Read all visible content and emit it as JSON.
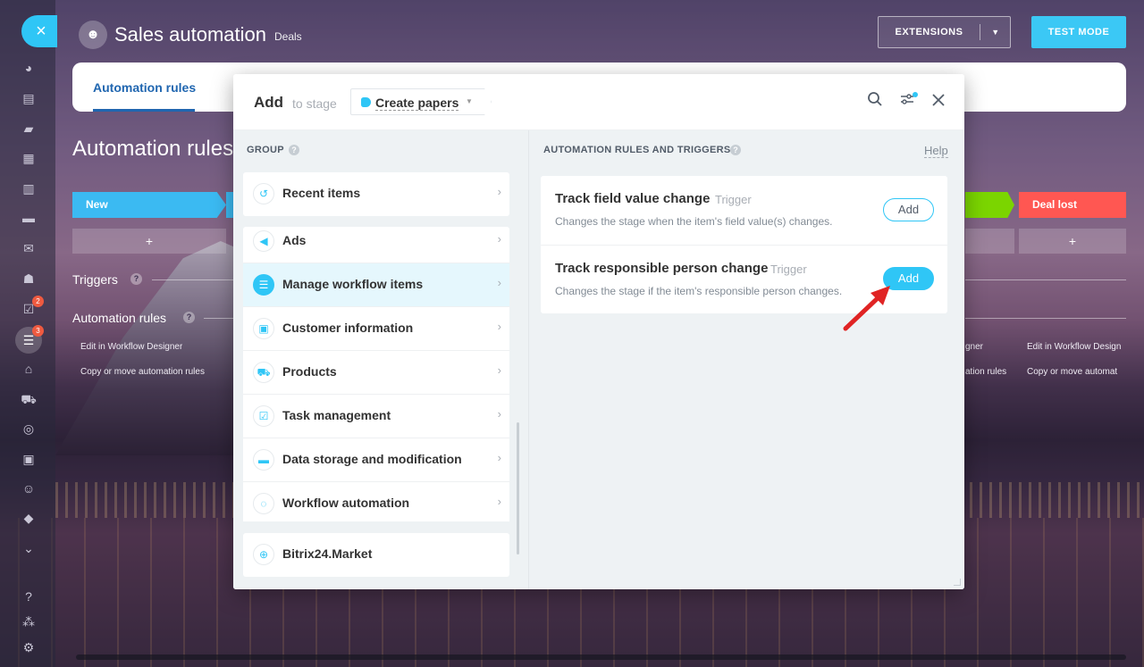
{
  "colors": {
    "accent": "#2fc6f6",
    "active_tab": "#2066b0",
    "stage_new": "#3bbaf2",
    "stage_won": "#7bd500",
    "stage_lost": "#ff5752",
    "annotation_arrow": "#e02424"
  },
  "sidebar": {
    "close_icon": "×",
    "badges": [
      "2",
      "3"
    ]
  },
  "header": {
    "title": "Sales automation",
    "subtitle": "Deals",
    "extensions_label": "EXTENSIONS",
    "test_mode_label": "TEST MODE"
  },
  "background": {
    "tab_active": "Automation rules",
    "heading": "Automation rules a",
    "stage_new": "New",
    "stage_lost": "Deal lost",
    "plus": "+",
    "triggers_label": "Triggers",
    "automation_rules_label": "Automation rules",
    "question_mark": "?",
    "link_edit": "Edit in Workflow Designer",
    "link_copy": "Copy or move automation rules",
    "link_edit_right_fragment": "gner",
    "link_copy_right_fragment": "ation rules",
    "link_edit_far_right": "Edit in Workflow Design",
    "link_copy_far_right": "Copy or move automat"
  },
  "popup": {
    "title": "Add",
    "to_stage": "to stage",
    "stage_name": "Create papers",
    "group_header": "GROUP",
    "rules_header": "AUTOMATION RULES AND TRIGGERS",
    "help_label": "Help",
    "groups": [
      {
        "label": "Recent items",
        "icon": "recent-icon"
      },
      {
        "label": "Ads",
        "icon": "megaphone-icon"
      },
      {
        "label": "Manage workflow items",
        "icon": "funnel-icon"
      },
      {
        "label": "Customer information",
        "icon": "contact-card-icon"
      },
      {
        "label": "Products",
        "icon": "cart-icon"
      },
      {
        "label": "Task management",
        "icon": "task-icon"
      },
      {
        "label": "Data storage and modification",
        "icon": "storage-icon"
      },
      {
        "label": "Workflow automation",
        "icon": "workflow-icon"
      }
    ],
    "market_label": "Bitrix24.Market",
    "rules": [
      {
        "title": "Track field value change",
        "tag": "Trigger",
        "description": "Changes the stage when the item's field value(s) changes.",
        "button": "Add"
      },
      {
        "title": "Track responsible person change",
        "tag": "Trigger",
        "description": "Changes the stage if the item's responsible person changes.",
        "button": "Add"
      }
    ]
  }
}
